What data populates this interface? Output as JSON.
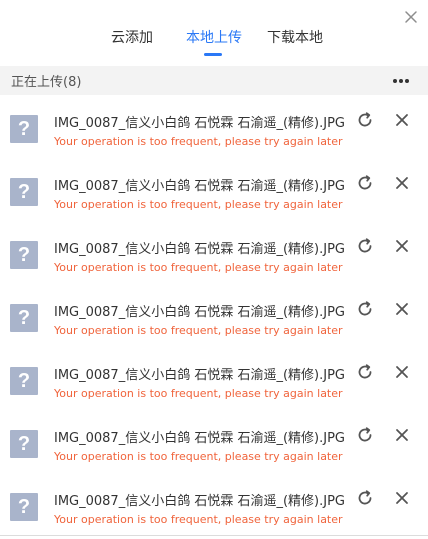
{
  "tabs": [
    {
      "label": "云添加",
      "active": false
    },
    {
      "label": "本地上传",
      "active": true
    },
    {
      "label": "下载本地",
      "active": false
    }
  ],
  "section": {
    "title": "正在上传(8)",
    "more_icon": "more-icon"
  },
  "icons": {
    "close": "close-icon",
    "retry": "retry-icon",
    "remove": "remove-icon",
    "file_unknown": "unknown-file-icon"
  },
  "colors": {
    "accent": "#2a78f6",
    "error": "#f0643c",
    "icon_bg": "#a9b4cb"
  },
  "uploads": [
    {
      "file_name": "IMG_0087_信义小白鸽 石悦霖 石渝遥_(精修).JPG",
      "status": "Your operation is too frequent, please try again later"
    },
    {
      "file_name": "IMG_0087_信义小白鸽 石悦霖 石渝遥_(精修).JPG",
      "status": "Your operation is too frequent, please try again later"
    },
    {
      "file_name": "IMG_0087_信义小白鸽 石悦霖 石渝遥_(精修).JPG",
      "status": "Your operation is too frequent, please try again later"
    },
    {
      "file_name": "IMG_0087_信义小白鸽 石悦霖 石渝遥_(精修).JPG",
      "status": "Your operation is too frequent, please try again later"
    },
    {
      "file_name": "IMG_0087_信义小白鸽 石悦霖 石渝遥_(精修).JPG",
      "status": "Your operation is too frequent, please try again later"
    },
    {
      "file_name": "IMG_0087_信义小白鸽 石悦霖 石渝遥_(精修).JPG",
      "status": "Your operation is too frequent, please try again later"
    },
    {
      "file_name": "IMG_0087_信义小白鸽 石悦霖 石渝遥_(精修).JPG",
      "status": "Your operation is too frequent, please try again later"
    }
  ]
}
